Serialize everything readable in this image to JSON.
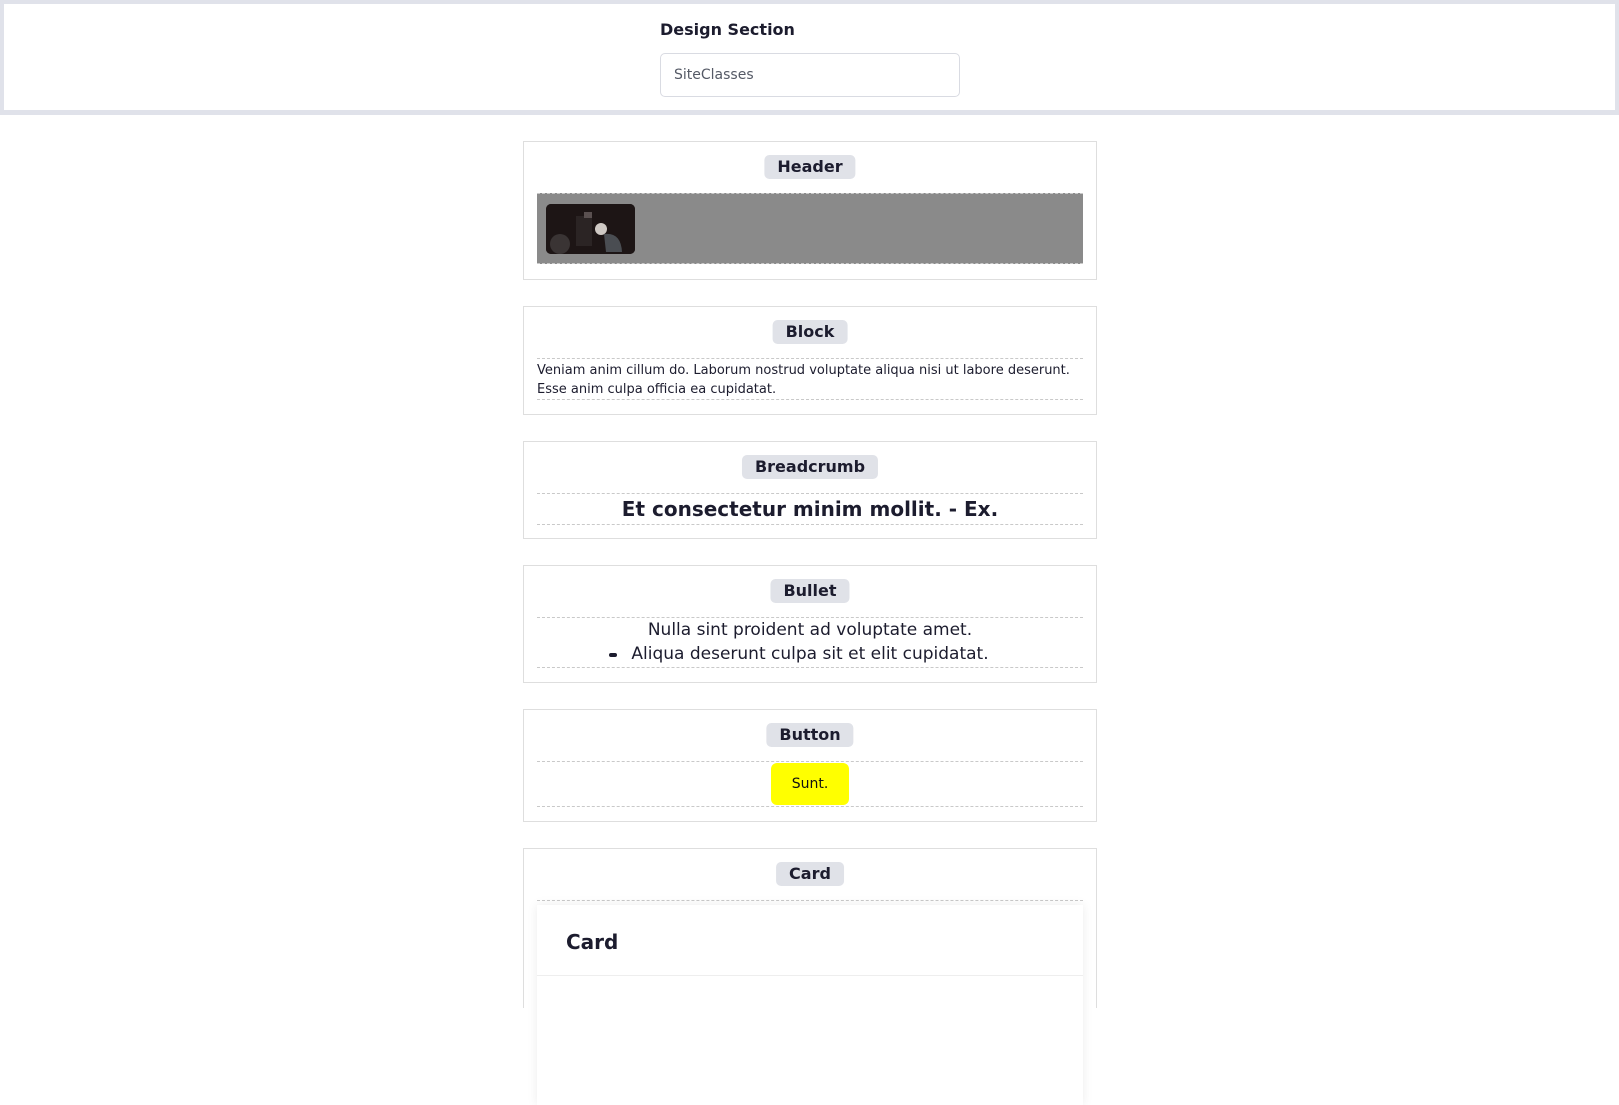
{
  "top": {
    "label": "Design Section",
    "select_value": "SiteClasses"
  },
  "sections": {
    "header": {
      "title": "Header"
    },
    "block": {
      "title": "Block",
      "text": "Veniam anim cillum do. Laborum nostrud voluptate aliqua nisi ut labore deserunt. Esse anim culpa officia ea cupidatat."
    },
    "breadcrumb": {
      "title": "Breadcrumb",
      "text": "Et consectetur minim mollit. - Ex."
    },
    "bullet": {
      "title": "Bullet",
      "line1": "Nulla sint proident ad voluptate amet.",
      "line2": "Aliqua deserunt culpa sit et elit cupidatat."
    },
    "button": {
      "title": "Button",
      "label": "Sunt.",
      "color": "#ffff00"
    },
    "card": {
      "title": "Card",
      "card_title": "Card"
    }
  },
  "colors": {
    "header_bar": "#8a8a8a",
    "pill_bg": "#e0e2e8"
  }
}
